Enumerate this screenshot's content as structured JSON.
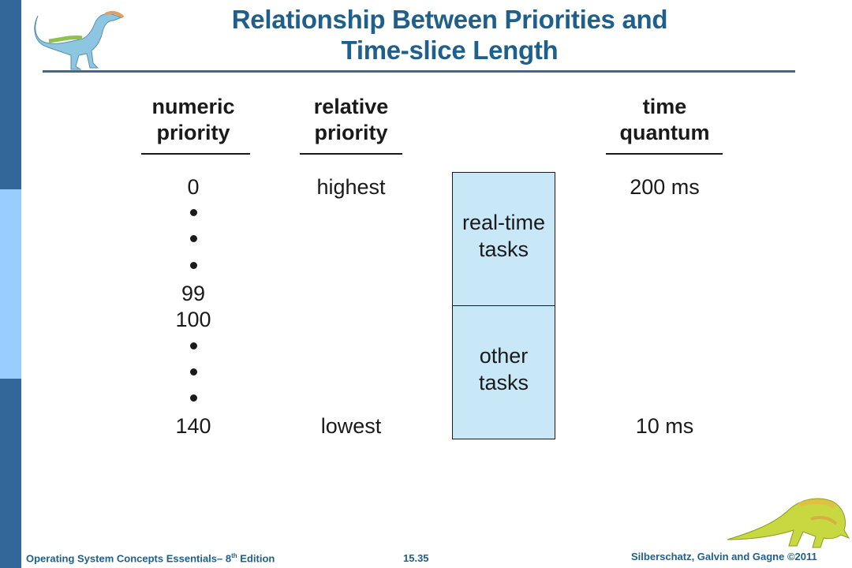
{
  "slide": {
    "title_line1": "Relationship Between Priorities and",
    "title_line2": "Time-slice Length",
    "colors": {
      "sidebar_dark": "#336699",
      "sidebar_light": "#99ccff",
      "title": "#1f5f8b",
      "box_fill": "#c8e8f8"
    }
  },
  "columns": {
    "numeric": {
      "line1": "numeric",
      "line2": "priority",
      "values": [
        "0",
        "99",
        "100",
        "140"
      ]
    },
    "relative": {
      "line1": "relative",
      "line2": "priority",
      "highest": "highest",
      "lowest": "lowest"
    },
    "quantum": {
      "line1": "time",
      "line2": "quantum",
      "top": "200 ms",
      "bottom": "10 ms"
    }
  },
  "boxes": {
    "realtime": {
      "line1": "real-time",
      "line2": "tasks"
    },
    "other": {
      "line1": "other",
      "line2": "tasks"
    }
  },
  "icons": {
    "top_left": "dinosaur-icon",
    "bottom_right": "dinosaur-icon"
  },
  "footer": {
    "left_prefix": "Operating System Concepts Essentials– 8",
    "left_sup": "th",
    "left_suffix": " Edition",
    "center": "15.35",
    "right": "Silberschatz, Galvin and Gagne ©2011"
  }
}
